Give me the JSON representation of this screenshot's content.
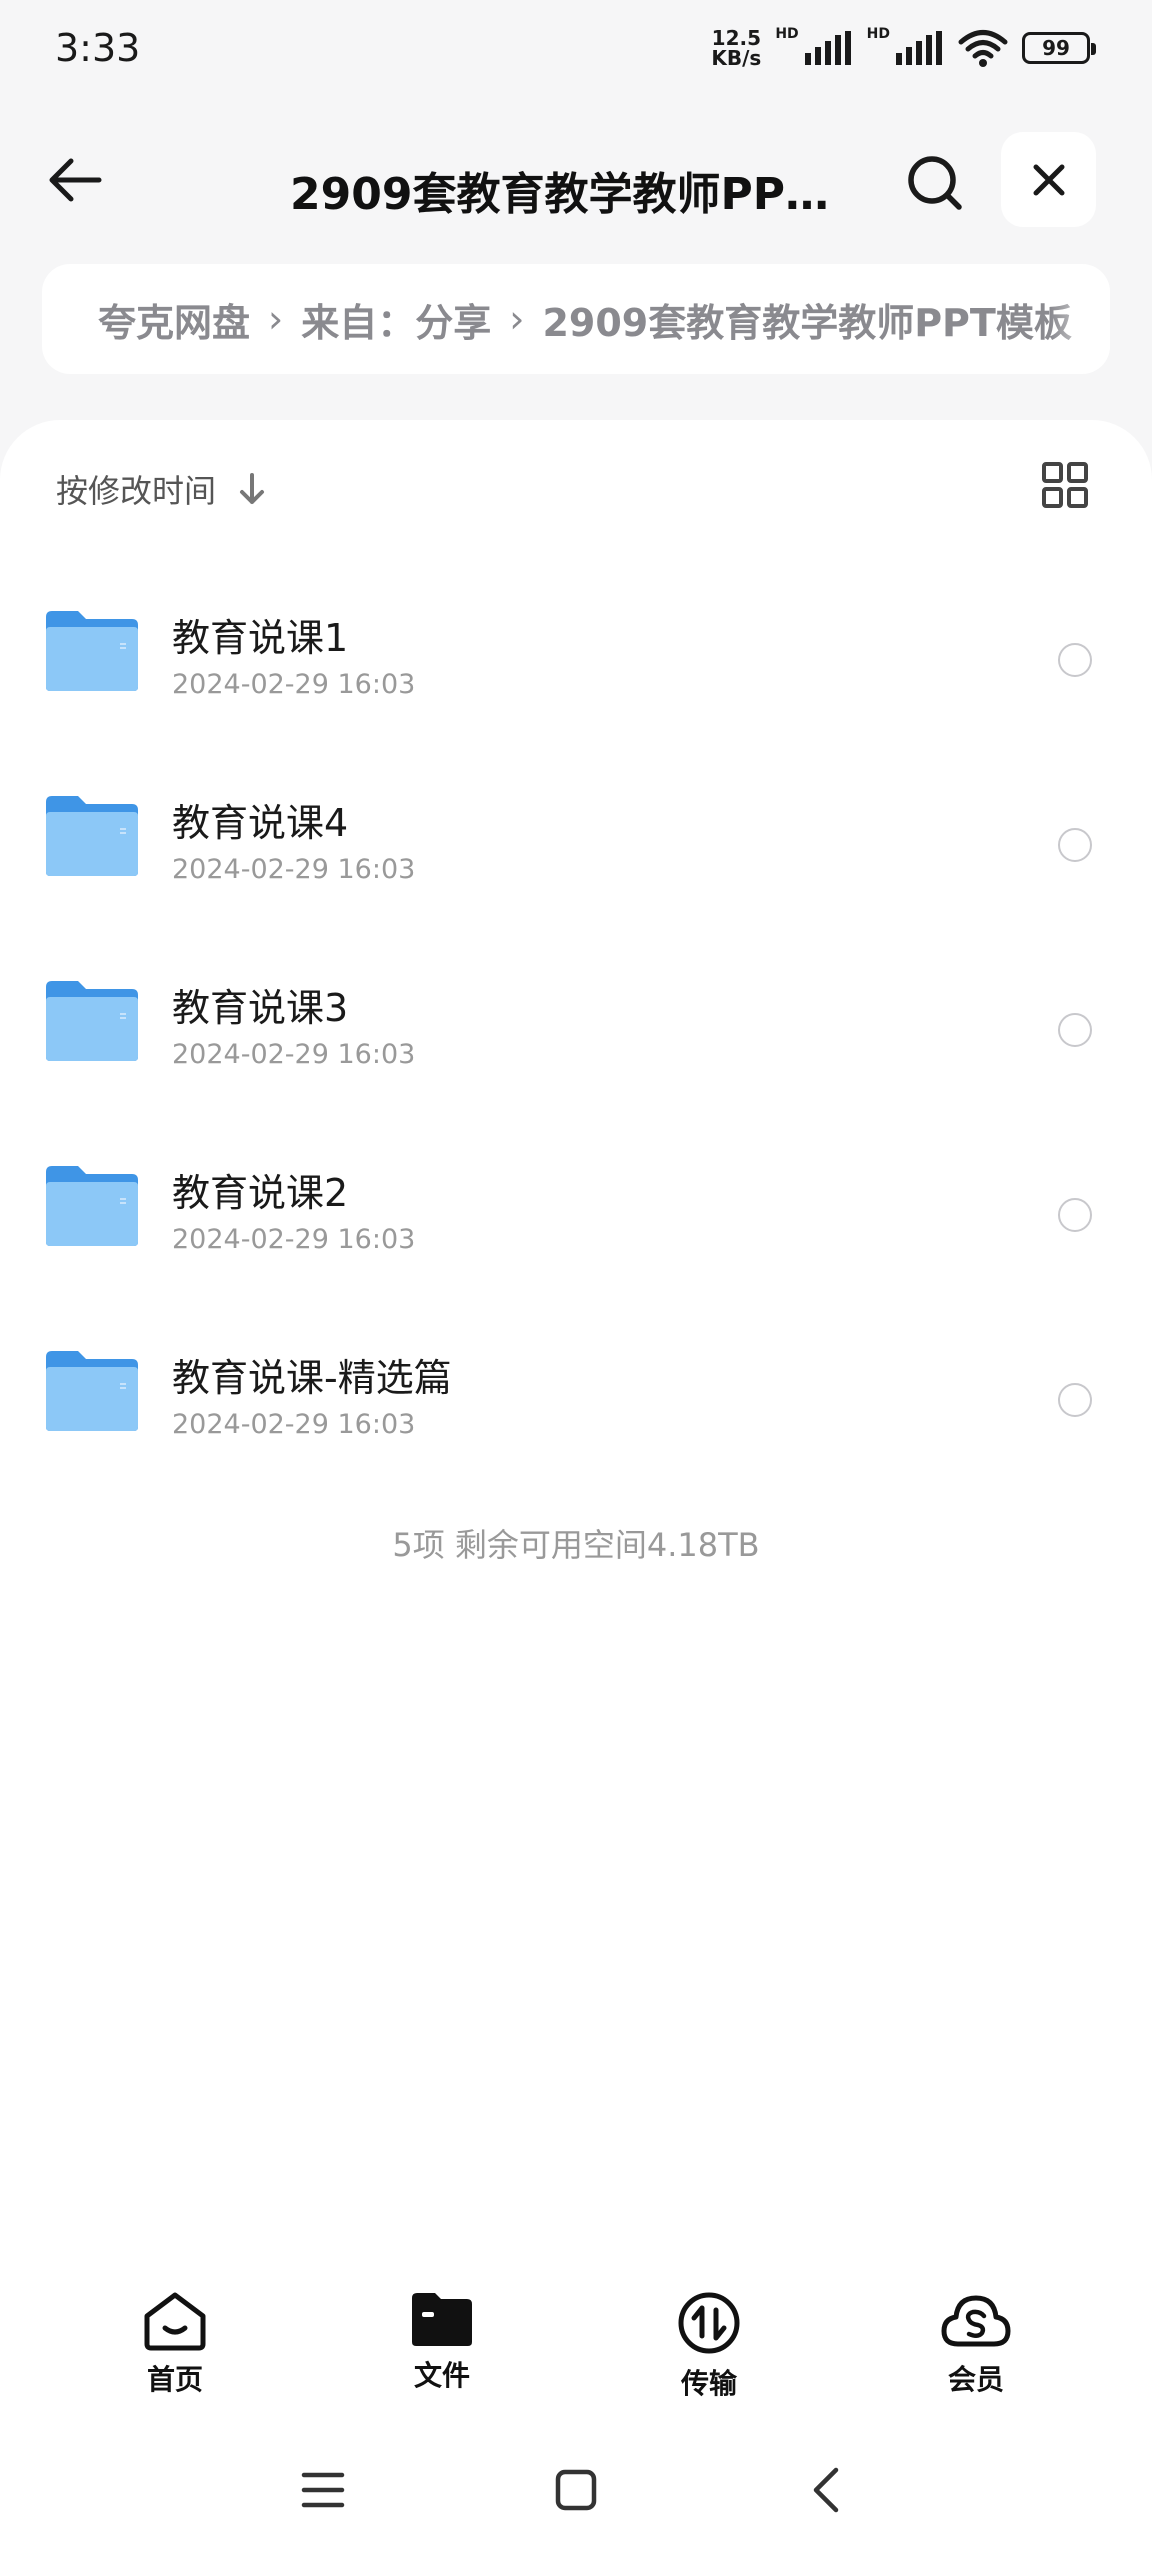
{
  "status_bar": {
    "time": "3:33",
    "net_speed_value": "12.5",
    "net_speed_unit": "KB/s",
    "hd_1": "HD",
    "hd_2": "HD",
    "battery": "99"
  },
  "header": {
    "title": "2909套教育教学教师PPT…"
  },
  "breadcrumb": {
    "items": [
      "夸克网盘",
      "来自：分享",
      "2909套教育教学教师PPT模板"
    ],
    "separator": "›"
  },
  "sort": {
    "label": "按修改时间"
  },
  "files": [
    {
      "name": "教育说课1",
      "date": "2024-02-29 16:03"
    },
    {
      "name": "教育说课4",
      "date": "2024-02-29 16:03"
    },
    {
      "name": "教育说课3",
      "date": "2024-02-29 16:03"
    },
    {
      "name": "教育说课2",
      "date": "2024-02-29 16:03"
    },
    {
      "name": "教育说课-精选篇",
      "date": "2024-02-29 16:03"
    }
  ],
  "summary": "5项 剩余可用空间4.18TB",
  "bottom_nav": {
    "home": "首页",
    "files": "文件",
    "transfer": "传输",
    "member": "会员"
  },
  "colors": {
    "folder": "#5aa9ee",
    "background": "#f6f6f7",
    "muted_text": "#999999"
  }
}
